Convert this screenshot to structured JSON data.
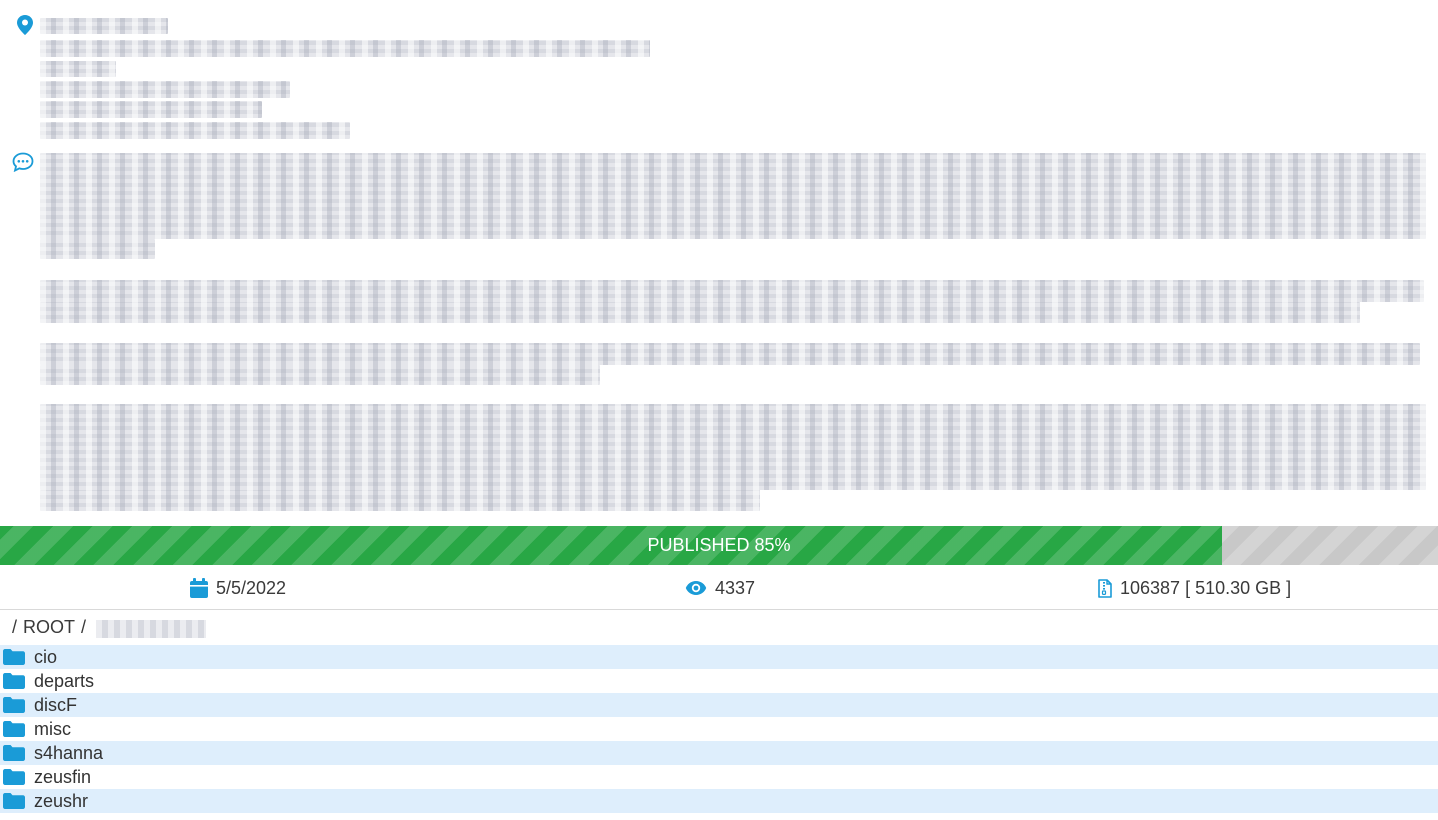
{
  "info": {
    "location_icon": "map-marker-icon",
    "comment_icon": "comment-dots-icon",
    "address_lines": [
      "",
      "",
      "",
      "",
      "",
      ""
    ],
    "description_paragraphs": [
      "",
      "",
      "",
      ""
    ]
  },
  "progress": {
    "label": "PUBLISHED 85%",
    "value_percent": 85,
    "fill_color": "#28a745",
    "track_color": "#c8c8c8"
  },
  "stats": {
    "date": "5/5/2022",
    "date_icon": "calendar-icon",
    "views": "4337",
    "views_icon": "eye-icon",
    "files": "106387 [ 510.30 GB ]",
    "files_icon": "file-archive-icon",
    "icon_color": "#1a9bd7"
  },
  "breadcrumb": {
    "separator": "/",
    "root": "ROOT"
  },
  "folders": [
    {
      "name": "cio"
    },
    {
      "name": "departs"
    },
    {
      "name": "discF"
    },
    {
      "name": "misc"
    },
    {
      "name": "s4hanna"
    },
    {
      "name": "zeusfin"
    },
    {
      "name": "zeushr"
    }
  ],
  "folder_icon": "folder-icon",
  "row_highlight_color": "#deeefc"
}
